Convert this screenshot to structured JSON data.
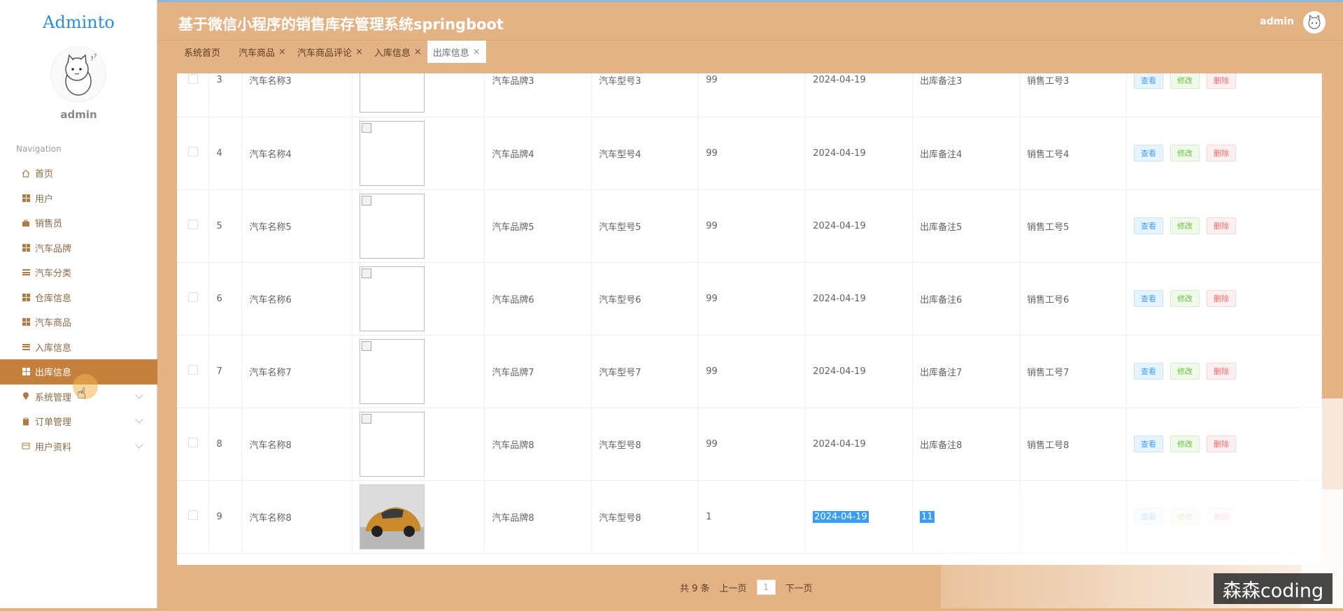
{
  "sidebar": {
    "logo": "Adminto",
    "username": "admin",
    "nav_caption": "Navigation",
    "items": [
      {
        "label": "首页",
        "icon": "home-icon"
      },
      {
        "label": "用户",
        "icon": "grid-icon"
      },
      {
        "label": "销售员",
        "icon": "briefcase-icon"
      },
      {
        "label": "汽车品牌",
        "icon": "grid-icon"
      },
      {
        "label": "汽车分类",
        "icon": "list-icon"
      },
      {
        "label": "仓库信息",
        "icon": "grid-icon"
      },
      {
        "label": "汽车商品",
        "icon": "grid-icon"
      },
      {
        "label": "入库信息",
        "icon": "list-icon"
      },
      {
        "label": "出库信息",
        "icon": "grid-icon",
        "active": true
      },
      {
        "label": "系统管理",
        "icon": "pin-icon",
        "expandable": true
      },
      {
        "label": "订单管理",
        "icon": "clipboard-icon",
        "expandable": true
      },
      {
        "label": "用户资料",
        "icon": "card-icon",
        "expandable": true
      }
    ]
  },
  "header": {
    "title": "基于微信小程序的销售库存管理系统springboot",
    "user": "admin"
  },
  "tabs": [
    {
      "label": "系统首页",
      "closable": false
    },
    {
      "label": "汽车商品",
      "closable": true
    },
    {
      "label": "汽车商品评论",
      "closable": true
    },
    {
      "label": "入库信息",
      "closable": true
    },
    {
      "label": "出库信息",
      "closable": true,
      "active": true
    }
  ],
  "tab_close_glyph": "×",
  "table": {
    "rows": [
      {
        "index": "3",
        "name": "汽车名称3",
        "image": "broken",
        "brand": "汽车品牌3",
        "model": "汽车型号3",
        "qty": "99",
        "date": "2024-04-19",
        "note": "出库备注3",
        "staff": "销售工号3"
      },
      {
        "index": "4",
        "name": "汽车名称4",
        "image": "broken",
        "brand": "汽车品牌4",
        "model": "汽车型号4",
        "qty": "99",
        "date": "2024-04-19",
        "note": "出库备注4",
        "staff": "销售工号4"
      },
      {
        "index": "5",
        "name": "汽车名称5",
        "image": "broken",
        "brand": "汽车品牌5",
        "model": "汽车型号5",
        "qty": "99",
        "date": "2024-04-19",
        "note": "出库备注5",
        "staff": "销售工号5"
      },
      {
        "index": "6",
        "name": "汽车名称6",
        "image": "broken",
        "brand": "汽车品牌6",
        "model": "汽车型号6",
        "qty": "99",
        "date": "2024-04-19",
        "note": "出库备注6",
        "staff": "销售工号6"
      },
      {
        "index": "7",
        "name": "汽车名称7",
        "image": "broken",
        "brand": "汽车品牌7",
        "model": "汽车型号7",
        "qty": "99",
        "date": "2024-04-19",
        "note": "出库备注7",
        "staff": "销售工号7"
      },
      {
        "index": "8",
        "name": "汽车名称8",
        "image": "broken",
        "brand": "汽车品牌8",
        "model": "汽车型号8",
        "qty": "99",
        "date": "2024-04-19",
        "note": "出库备注8",
        "staff": "销售工号8"
      },
      {
        "index": "9",
        "name": "汽车名称8",
        "image": "car-photo",
        "brand": "汽车品牌8",
        "model": "汽车型号8",
        "qty": "1",
        "date": "2024-04-19",
        "note": "11",
        "staff": ""
      }
    ],
    "actions": {
      "view": "查看",
      "edit": "修改",
      "delete": "删除"
    }
  },
  "pagination": {
    "total_text": "共 9 条",
    "prev": "上一页",
    "current_page": "1",
    "next": "下一页"
  },
  "watermark": "森森coding",
  "colors": {
    "header_bg": "#e4b385",
    "sidebar_active": "#c6803e",
    "view_btn": "#409eff",
    "edit_btn": "#67c23a",
    "delete_btn": "#f56c6c"
  }
}
